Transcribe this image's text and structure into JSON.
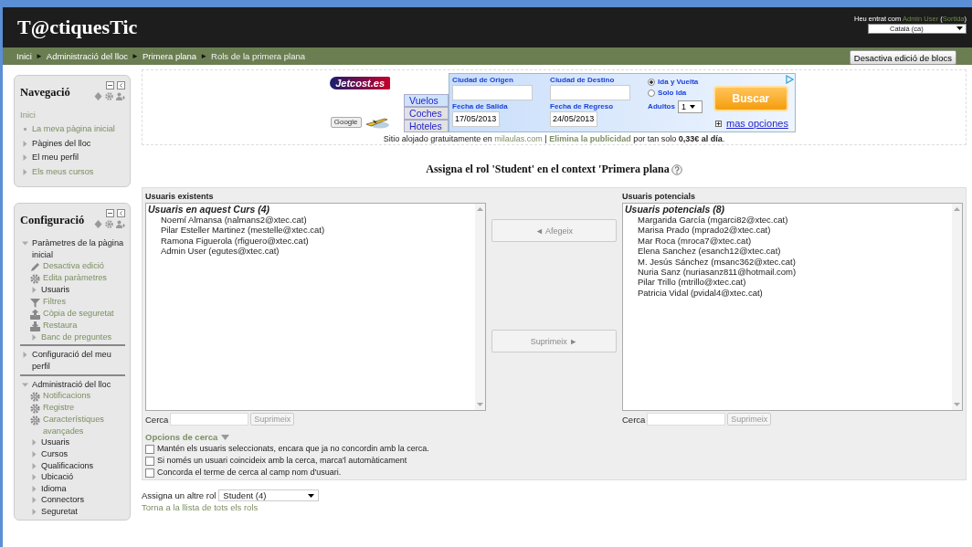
{
  "header": {
    "site_title": "T@ctiquesTic",
    "login_text": "Heu entrat com",
    "user_link": "Admin User",
    "logout_link": "Sortida",
    "brackets": [
      "(",
      ")"
    ],
    "language": "Català (ca)"
  },
  "breadcrumb": {
    "separator": "►",
    "items": [
      "Inici",
      "Administració del lloc",
      "Primera plana",
      "Rols de la primera plana"
    ]
  },
  "edit_blocks_button": "Desactiva edició de blocs",
  "navigation": {
    "title": "Navegació",
    "root": "Inici",
    "items": [
      {
        "label": "La meva pàgina inicial",
        "kind": "leaf",
        "link": true
      },
      {
        "label": "Pàgines del lloc",
        "kind": "branch",
        "link": false
      },
      {
        "label": "El meu perfil",
        "kind": "branch",
        "link": false
      },
      {
        "label": "Els meus cursos",
        "kind": "branch",
        "link": true
      }
    ]
  },
  "settings": {
    "title": "Configuració",
    "sections": [
      {
        "label": "Paràmetres de la pàgina inicial",
        "expanded": true,
        "children": [
          {
            "label": "Desactiva edició",
            "kind": "pencil",
            "link": true
          },
          {
            "label": "Edita paràmetres",
            "kind": "gear",
            "link": true
          },
          {
            "label": "Usuaris",
            "kind": "branch",
            "link": false
          },
          {
            "label": "Filtres",
            "kind": "filter",
            "link": true
          },
          {
            "label": "Còpia de seguretat",
            "kind": "upload",
            "link": true
          },
          {
            "label": "Restaura",
            "kind": "download",
            "link": true
          },
          {
            "label": "Banc de preguntes",
            "kind": "branch",
            "link": true
          }
        ]
      },
      {
        "label": "Configuració del meu perfil",
        "expanded": false
      },
      {
        "label": "Administració del lloc",
        "expanded": true,
        "children": [
          {
            "label": "Notificacions",
            "kind": "gear",
            "link": true
          },
          {
            "label": "Registre",
            "kind": "gear",
            "link": true
          },
          {
            "label": "Característiques avançades",
            "kind": "gear",
            "link": true
          },
          {
            "label": "Usuaris",
            "kind": "branch",
            "link": false
          },
          {
            "label": "Cursos",
            "kind": "branch",
            "link": false
          },
          {
            "label": "Qualificacions",
            "kind": "branch",
            "link": false
          },
          {
            "label": "Ubicació",
            "kind": "branch",
            "link": false
          },
          {
            "label": "Idioma",
            "kind": "branch",
            "link": false
          },
          {
            "label": "Connectors",
            "kind": "branch",
            "link": false
          },
          {
            "label": "Seguretat",
            "kind": "branch",
            "link": false
          }
        ]
      }
    ]
  },
  "ad": {
    "logo": "Jetcost.es",
    "google_button": "Google",
    "tabs": [
      {
        "label": "Vuelos",
        "selected": true
      },
      {
        "label": "Coches",
        "selected": false
      },
      {
        "label": "Hoteles",
        "selected": false
      }
    ],
    "origin_label": "Ciudad de Origen",
    "destination_label": "Ciudad de Destino",
    "departure_label": "Fecha de Salida",
    "departure_value": "17/05/2013",
    "return_label": "Fecha de Regreso",
    "return_value": "24/05/2013",
    "trip_options": [
      {
        "label": "Ida y Vuelta",
        "selected": true
      },
      {
        "label": "Solo Ida",
        "selected": false
      }
    ],
    "adults_label": "Adultos",
    "adults_value": "1",
    "search_button": "Buscar",
    "more_options": "mas opciones"
  },
  "hosting_notice": {
    "before": "Sitio alojado gratuitamente en",
    "site_link": "milaulas.com",
    "separator": "|",
    "remove_ads_link": "Elimina la publicidad",
    "after": "por tan solo **0,33€ al día**."
  },
  "heading": "Assigna el rol 'Student' en el context 'Primera plana",
  "existing": {
    "title": "Usuaris existents",
    "group": "Usuaris en aquest Curs (4)",
    "users": [
      "Noemí Almansa (nalmans2@xtec.cat)",
      "Pilar Esteller Martinez (mestelle@xtec.cat)",
      "Ramona Figuerola (rfiguero@xtec.cat)",
      "Admin User (egutes@xtec.cat)"
    ],
    "search_label": "Cerca",
    "clear_button": "Suprimeix",
    "clear_disabled": true
  },
  "potential": {
    "title": "Usuaris potencials",
    "group": "Usuaris potencials (8)",
    "users": [
      "Margarida García (mgarci82@xtec.cat)",
      "Marisa Prado (mprado2@xtec.cat)",
      "Mar Roca (mroca7@xtec.cat)",
      "Elena Sanchez (esanch12@xtec.cat)",
      "M. Jesús Sánchez (msanc362@xtec.cat)",
      "Nuria Sanz (nuriasanz811@hotmail.com)",
      "Pilar Trillo (mtrillo@xtec.cat)",
      "Patricia Vidal (pvidal4@xtec.cat)"
    ],
    "search_label": "Cerca",
    "clear_button": "Suprimeix",
    "clear_disabled": true
  },
  "add_button": {
    "label": "◄ Afegeix",
    "disabled": true
  },
  "remove_button": {
    "label": "Suprimeix ►",
    "disabled": true
  },
  "search_options": {
    "title": "Opcions de cerca",
    "options": [
      {
        "label": "Mantén els usuaris seleccionats, encara que ja no concordin amb la cerca.",
        "checked": false
      },
      {
        "label": "Si només un usuari coincideix amb la cerca, marca'l automàticament",
        "checked": false
      },
      {
        "label": "Concorda el terme de cerca al camp nom d'usuari.",
        "checked": false
      }
    ]
  },
  "other_role": {
    "label": "Assigna un altre rol",
    "value": "Student (4)",
    "back_link": "Torna a la llista de tots els rols"
  }
}
